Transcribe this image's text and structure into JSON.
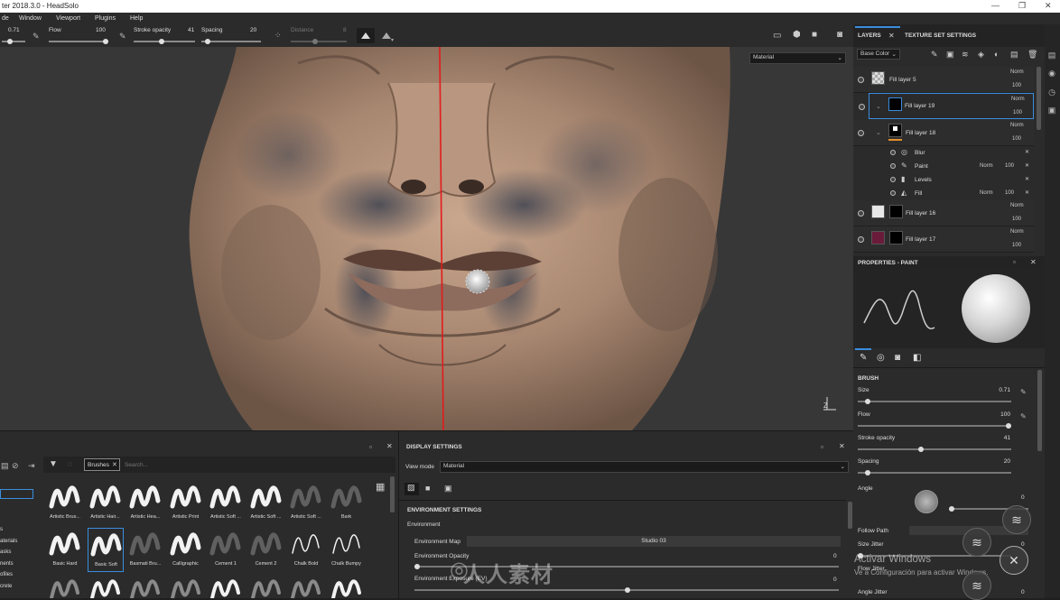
{
  "window": {
    "title": "ter 2018.3.0 - HeadSolo",
    "controls": [
      "—",
      "❐",
      "✕"
    ]
  },
  "menu": [
    "de",
    "Window",
    "Viewport",
    "Plugins",
    "Help"
  ],
  "toolbar": {
    "size_value": "0.71",
    "flow_label": "Flow",
    "flow_value": "100",
    "stroke_opacity_label": "Stroke opacity",
    "stroke_opacity_value": "41",
    "spacing_label": "Spacing",
    "spacing_value": "20",
    "distance_label": "Distance",
    "distance_value": "8"
  },
  "viewport": {
    "mode_select": "Material"
  },
  "layers_panel": {
    "tabs": [
      "LAYERS",
      "TEXTURE SET SETTINGS"
    ],
    "channel": "Base Color",
    "layers": [
      {
        "name": "Fill layer 5",
        "blend": "Norm",
        "opacity": "100",
        "thumb": "#d8d8d8",
        "mask": ""
      },
      {
        "name": "Fill layer 19",
        "blend": "Norm",
        "opacity": "100",
        "thumb": "",
        "mask": "#000000"
      },
      {
        "name": "Fill layer 18",
        "blend": "Norm",
        "opacity": "100",
        "thumb": "",
        "mask": "#000000"
      },
      {
        "name": "Fill layer 16",
        "blend": "Norm",
        "opacity": "100",
        "thumb": "#e8e8e8",
        "mask": "#000000"
      },
      {
        "name": "Fill layer 17",
        "blend": "Norm",
        "opacity": "100",
        "thumb": "#6a1b3a",
        "mask": "#000000"
      }
    ],
    "effects": [
      {
        "name": "Blur",
        "blend": "",
        "opacity": ""
      },
      {
        "name": "Paint",
        "blend": "Norm",
        "opacity": "100"
      },
      {
        "name": "Levels",
        "blend": "",
        "opacity": ""
      },
      {
        "name": "Fill",
        "blend": "Norm",
        "opacity": "100"
      }
    ]
  },
  "properties": {
    "title": "PROPERTIES - PAINT",
    "section": "BRUSH",
    "params": [
      {
        "label": "Size",
        "value": "0.71",
        "level": 0.05
      },
      {
        "label": "Flow",
        "value": "100",
        "level": 1.0
      },
      {
        "label": "Stroke opacity",
        "value": "41",
        "level": 0.41
      },
      {
        "label": "Spacing",
        "value": "20",
        "level": 0.05
      }
    ],
    "angle_label": "Angle",
    "angle_value": "0",
    "follow_path_label": "Follow Path",
    "size_jitter_label": "Size Jitter",
    "size_jitter_value": "0",
    "flow_jitter_label": "Flow Jitter",
    "angle_jitter_label": "Angle Jitter",
    "angle_jitter_value": "0"
  },
  "shelf": {
    "filter_tag": "Brushes",
    "search_placeholder": "Search...",
    "side_items": [
      "s",
      "aterials",
      "asks",
      "nents",
      "ofiles",
      "crete"
    ],
    "brushes_row1": [
      "Artistic Brus...",
      "Artistic Hair...",
      "Artistic Hea...",
      "Artistic Print",
      "Artistic Soft ...",
      "Artistic Soft ...",
      "Artistic Soft ...",
      "Bark"
    ],
    "brushes_row2": [
      "Basic Hard",
      "Basic Soft",
      "Basmati Bru...",
      "Calligraphic",
      "Cement 1",
      "Cement 2",
      "Chalk Bold",
      "Chalk Bumpy"
    ]
  },
  "display_settings": {
    "title": "DISPLAY SETTINGS",
    "view_mode_label": "View mode",
    "view_mode_value": "Material",
    "env_section": "ENVIRONMENT SETTINGS",
    "env_label": "Environment",
    "env_map_label": "Environment Map",
    "env_map_value": "Studio 03",
    "env_opacity_label": "Environment Opacity",
    "env_opacity_value": "0",
    "env_exposure_label": "Environment Exposure (EV)",
    "env_exposure_value": "0"
  },
  "watermark": {
    "activate_title": "Activar Windows",
    "activate_sub": "Ve a Configuración para activar Windows.",
    "site_text": "人人素材"
  },
  "colors": {
    "accent": "#3a8dde",
    "panel": "#2b2b2b",
    "seam": "#e21b1b"
  }
}
